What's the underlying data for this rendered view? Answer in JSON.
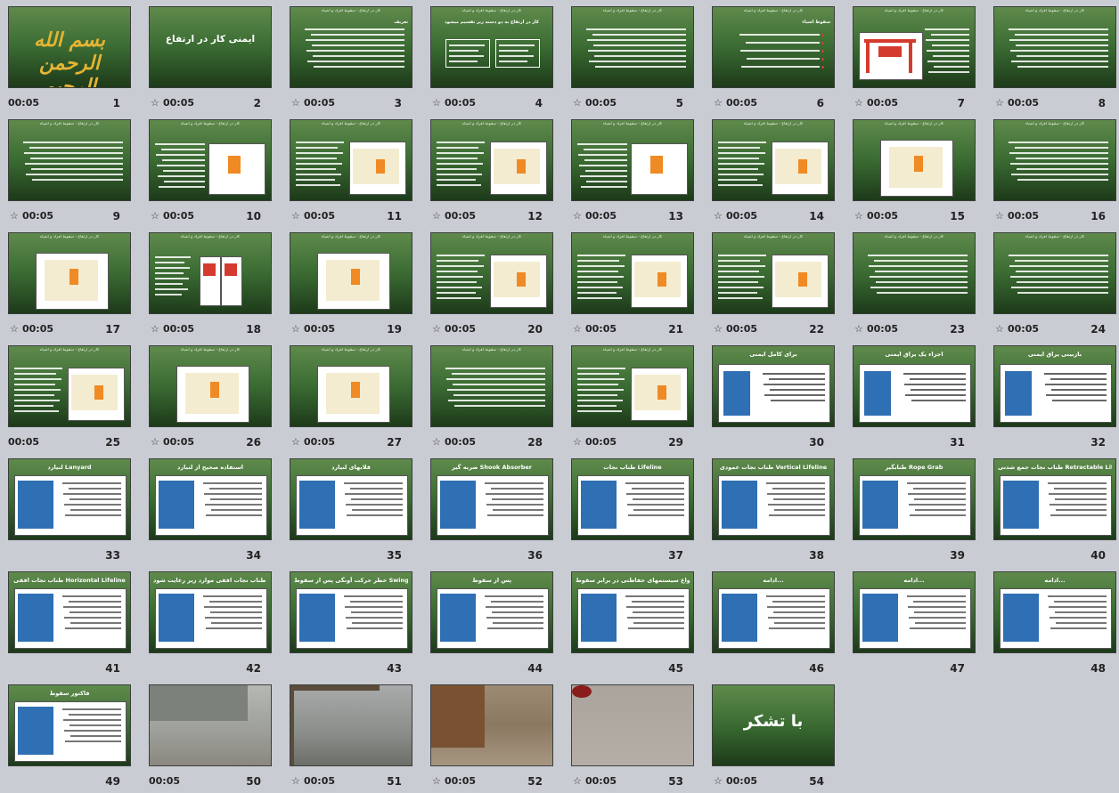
{
  "header_text": "کار در ارتفاع - سقوط افراد و اشیاء",
  "slides": [
    {
      "n": "1",
      "time": "00:05",
      "star": false,
      "kind": "bismillah",
      "title": "بسم الله الرحمن الرحیم"
    },
    {
      "n": "2",
      "time": "00:05",
      "star": true,
      "kind": "title",
      "title": "ایمنی کار در ارتفاع"
    },
    {
      "n": "3",
      "time": "00:05",
      "star": true,
      "kind": "text",
      "title": "تعریف"
    },
    {
      "n": "4",
      "time": "00:05",
      "star": true,
      "kind": "diagram",
      "title": "کار در ارتفاع به دو دسته زیر تقسیم میشود"
    },
    {
      "n": "5",
      "time": "00:05",
      "star": true,
      "kind": "text",
      "title": ""
    },
    {
      "n": "6",
      "time": "00:05",
      "star": true,
      "kind": "bullets",
      "title": "سقوط اشیاء"
    },
    {
      "n": "7",
      "time": "00:05",
      "star": true,
      "kind": "barrier",
      "title": ""
    },
    {
      "n": "8",
      "time": "00:05",
      "star": true,
      "kind": "text",
      "title": ""
    },
    {
      "n": "9",
      "time": "00:05",
      "star": true,
      "kind": "text",
      "title": ""
    },
    {
      "n": "10",
      "time": "00:05",
      "star": true,
      "kind": "img-right",
      "title": ""
    },
    {
      "n": "11",
      "time": "00:05",
      "star": true,
      "kind": "img-left",
      "title": ""
    },
    {
      "n": "12",
      "time": "00:05",
      "star": true,
      "kind": "img-left",
      "title": ""
    },
    {
      "n": "13",
      "time": "00:05",
      "star": true,
      "kind": "img-right",
      "title": ""
    },
    {
      "n": "14",
      "time": "00:05",
      "star": true,
      "kind": "img-left",
      "title": ""
    },
    {
      "n": "15",
      "time": "00:05",
      "star": true,
      "kind": "img-center",
      "title": ""
    },
    {
      "n": "16",
      "time": "00:05",
      "star": true,
      "kind": "text",
      "title": ""
    },
    {
      "n": "17",
      "time": "00:05",
      "star": true,
      "kind": "img-center",
      "title": ""
    },
    {
      "n": "18",
      "time": "00:05",
      "star": true,
      "kind": "signs",
      "title": ""
    },
    {
      "n": "19",
      "time": "00:05",
      "star": true,
      "kind": "img-center",
      "title": ""
    },
    {
      "n": "20",
      "time": "00:05",
      "star": true,
      "kind": "img-left",
      "title": ""
    },
    {
      "n": "21",
      "time": "00:05",
      "star": true,
      "kind": "img-left",
      "title": ""
    },
    {
      "n": "22",
      "time": "00:05",
      "star": true,
      "kind": "img-left",
      "title": ""
    },
    {
      "n": "23",
      "time": "00:05",
      "star": true,
      "kind": "text",
      "title": ""
    },
    {
      "n": "24",
      "time": "00:05",
      "star": true,
      "kind": "text",
      "title": ""
    },
    {
      "n": "25",
      "time": "00:05",
      "star": false,
      "kind": "img-left",
      "title": ""
    },
    {
      "n": "26",
      "time": "00:05",
      "star": true,
      "kind": "img-center",
      "title": ""
    },
    {
      "n": "27",
      "time": "00:05",
      "star": true,
      "kind": "img-center",
      "title": ""
    },
    {
      "n": "28",
      "time": "00:05",
      "star": true,
      "kind": "text",
      "title": ""
    },
    {
      "n": "29",
      "time": "00:05",
      "star": true,
      "kind": "img-left",
      "title": ""
    },
    {
      "n": "30",
      "time": "",
      "star": false,
      "kind": "harness",
      "title": "برای کامل ایمنی"
    },
    {
      "n": "31",
      "time": "",
      "star": false,
      "kind": "harness",
      "title": "اجزاء یک یراق ایمنی"
    },
    {
      "n": "32",
      "time": "",
      "star": false,
      "kind": "harness",
      "title": "بازبینی یراق ایمنی"
    },
    {
      "n": "33",
      "time": "",
      "star": false,
      "kind": "white",
      "title": "لنیارد Lanyard"
    },
    {
      "n": "34",
      "time": "",
      "star": false,
      "kind": "white",
      "title": "استفاده صحیح از لنیارد"
    },
    {
      "n": "35",
      "time": "",
      "star": false,
      "kind": "white",
      "title": "قلابهای لنیارد"
    },
    {
      "n": "36",
      "time": "",
      "star": false,
      "kind": "white",
      "title": "ضربه گیر Shook Absorber"
    },
    {
      "n": "37",
      "time": "",
      "star": false,
      "kind": "white",
      "title": "طناب نجات Lifeline"
    },
    {
      "n": "38",
      "time": "",
      "star": false,
      "kind": "white",
      "title": "طناب نجات عمودی Vertical Lifeline"
    },
    {
      "n": "39",
      "time": "",
      "star": false,
      "kind": "white",
      "title": "طنابگیر Rope Grab"
    },
    {
      "n": "40",
      "time": "",
      "star": false,
      "kind": "white",
      "title": "طناب نجات جمع شدنی Retractable Lifeline"
    },
    {
      "n": "41",
      "time": "",
      "star": false,
      "kind": "white",
      "title": "طناب نجات افقی Horizontal Lifeline"
    },
    {
      "n": "42",
      "time": "",
      "star": false,
      "kind": "white",
      "title": "در هنگام استفاده از طناب نجات افقی موارد زیر رعایت شود"
    },
    {
      "n": "43",
      "time": "",
      "star": false,
      "kind": "white",
      "title": "خطر حرکت آونگی پس از سقوط Swing movement Hazard"
    },
    {
      "n": "44",
      "time": "",
      "star": false,
      "kind": "white",
      "title": "پس از سقوط"
    },
    {
      "n": "45",
      "time": "",
      "star": false,
      "kind": "white",
      "title": "انواع سیستمهای حفاظتی در برابر سقوط"
    },
    {
      "n": "46",
      "time": "",
      "star": false,
      "kind": "white",
      "title": "ادامه..."
    },
    {
      "n": "47",
      "time": "",
      "star": false,
      "kind": "white",
      "title": "ادامه..."
    },
    {
      "n": "48",
      "time": "",
      "star": false,
      "kind": "white",
      "title": "ادامه..."
    },
    {
      "n": "49",
      "time": "",
      "star": false,
      "kind": "white",
      "title": "فاکتور سقوط"
    },
    {
      "n": "50",
      "time": "00:05",
      "star": false,
      "kind": "photo1",
      "title": ""
    },
    {
      "n": "51",
      "time": "00:05",
      "star": true,
      "kind": "photo2",
      "title": ""
    },
    {
      "n": "52",
      "time": "00:05",
      "star": true,
      "kind": "photo3",
      "title": ""
    },
    {
      "n": "53",
      "time": "00:05",
      "star": true,
      "kind": "photo4",
      "title": ""
    },
    {
      "n": "54",
      "time": "00:05",
      "star": true,
      "kind": "thanks",
      "title": "با تشکر"
    }
  ],
  "colors": {
    "slide_green": "#3a6b32",
    "background": "#c9ccd3"
  }
}
